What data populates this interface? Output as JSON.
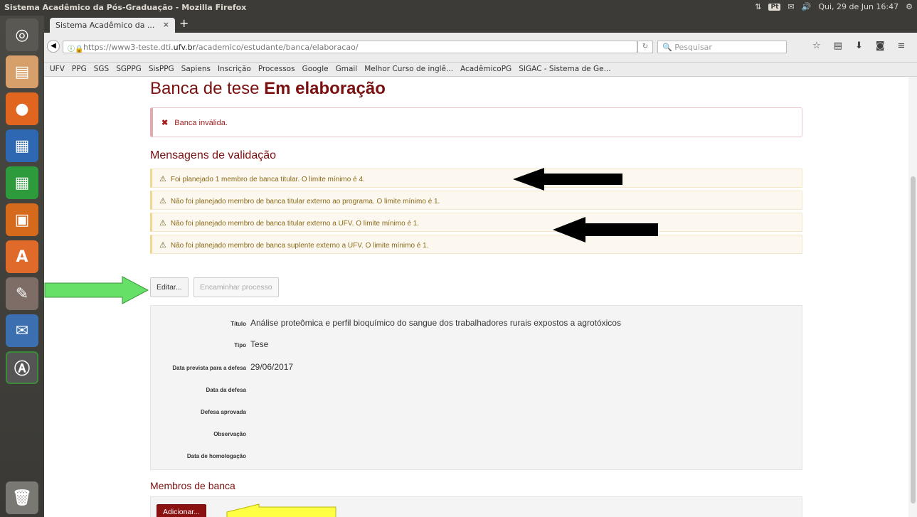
{
  "os": {
    "window_title": "Sistema Acadêmico da Pós-Graduação - Mozilla Firefox",
    "tray": {
      "badge": "Pt",
      "clock": "Qui, 29 de Jun 16:47"
    }
  },
  "launcher": {
    "icons": [
      "ubuntu-dash-icon",
      "files-icon",
      "firefox-icon",
      "writer-icon",
      "calc-icon",
      "impress-icon",
      "software-center-icon",
      "settings-icon",
      "thunderbird-icon",
      "update-icon",
      "trash-icon"
    ]
  },
  "browser": {
    "tab_title": "Sistema Acadêmico da ...",
    "tab_close": "×",
    "new_tab": "+",
    "url_prefix": "https://www3-teste.dti.",
    "url_domain": "ufv.br",
    "url_path": "/academico/estudante/banca/elaboracao/",
    "search_placeholder": "Pesquisar",
    "bookmarks": [
      "UFV",
      "PPG",
      "SGS",
      "SGPPG",
      "SisPPG",
      "Sapiens",
      "Inscrição",
      "Processos",
      "Google",
      "Gmail",
      "Melhor Curso de inglê...",
      "AcadêmicoPG",
      "SIGAC - Sistema de Ge..."
    ]
  },
  "page": {
    "title_prefix": "Banca de tese",
    "title_status": "Em elaboração",
    "alert_icon": "✖",
    "alert_text": "Banca inválida.",
    "validation_heading": "Mensagens de validação",
    "warnings": [
      "Foi planejado 1 membro de banca titular. O limite mínimo é 4.",
      "Não foi planejado membro de banca titular externo ao programa. O limite mínimo é 1.",
      "Não foi planejado membro de banca titular externo a UFV. O limite mínimo é 1.",
      "Não foi planejado membro de banca suplente externo a UFV. O limite mínimo é 1."
    ],
    "warn_icon": "⚠",
    "edit_button": "Editar...",
    "forward_button": "Encaminhar processo",
    "details": [
      {
        "label": "Título",
        "value": "Análise proteômica e perfil bioquímico do sangue dos trabalhadores rurais expostos a agrotóxicos"
      },
      {
        "label": "Tipo",
        "value": "Tese"
      },
      {
        "label": "Data prevista para a defesa",
        "value": "29/06/2017"
      },
      {
        "label": "Data da defesa",
        "value": ""
      },
      {
        "label": "Defesa aprovada",
        "value": ""
      },
      {
        "label": "Observação",
        "value": ""
      },
      {
        "label": "Data de homologação",
        "value": ""
      }
    ],
    "members_heading": "Membros de banca",
    "add_button": "Adicionar..."
  },
  "colors": {
    "brand": "#7b1010",
    "warning_bg": "#fcf8ef",
    "arrow_green": "#66e066",
    "arrow_yellow": "#ffff44",
    "arrow_black": "#000000"
  }
}
